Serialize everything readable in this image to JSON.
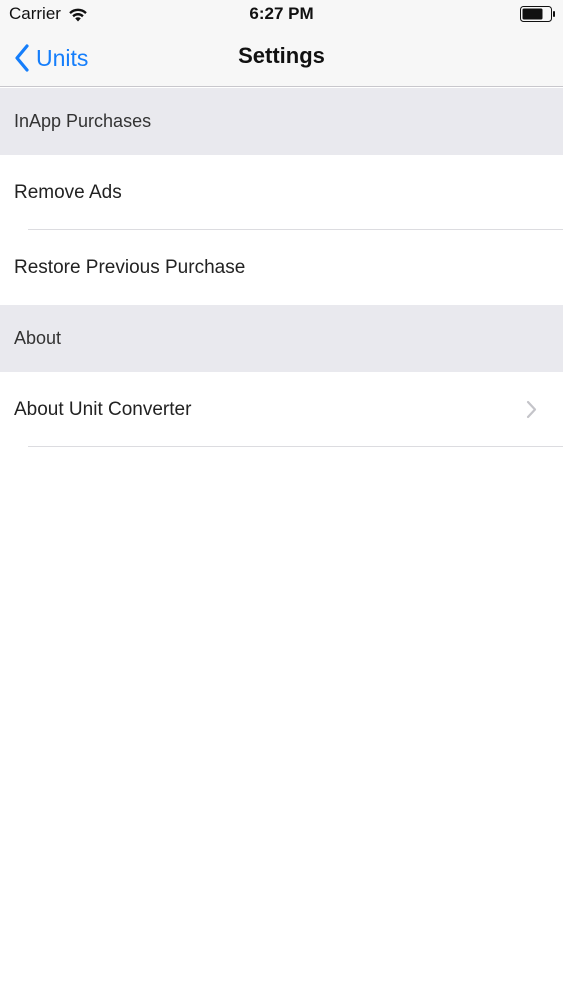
{
  "status_bar": {
    "carrier": "Carrier",
    "time": "6:27 PM",
    "wifi_icon": "wifi-icon",
    "battery_icon": "battery-icon"
  },
  "nav": {
    "back_label": "Units",
    "back_icon": "chevron-left-icon",
    "title": "Settings"
  },
  "sections": [
    {
      "header": "InApp Purchases",
      "rows": [
        {
          "label": "Remove Ads"
        },
        {
          "label": "Restore Previous Purchase"
        }
      ]
    },
    {
      "header": "About",
      "rows": [
        {
          "label": "About Unit Converter",
          "accessory": "chevron-right-icon"
        }
      ]
    }
  ],
  "colors": {
    "accent": "#157efb",
    "bar_background": "#f7f7f7",
    "section_background": "#e9e9ee"
  }
}
